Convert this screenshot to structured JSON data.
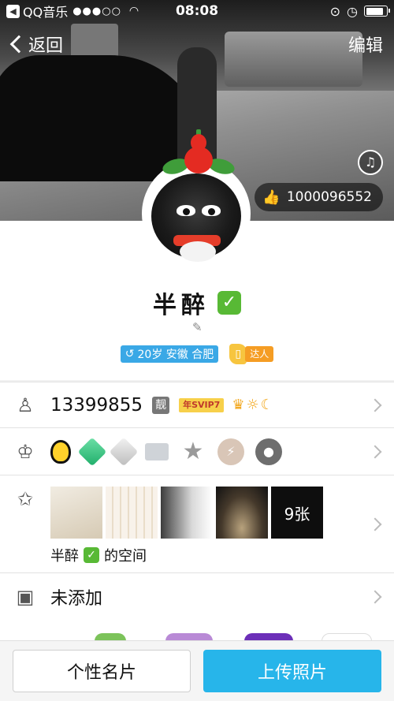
{
  "status_bar": {
    "app_name": "QQ音乐",
    "signal": "●●●○○",
    "wifi_icon": "wifi-icon",
    "time": "08:08"
  },
  "nav": {
    "back_label": "返回",
    "edit_label": "编辑"
  },
  "cover": {
    "likes": "1000096552"
  },
  "profile": {
    "name": "半醉",
    "tag_info": "20岁 安徽 合肥",
    "tag_daren": "达人"
  },
  "rows": {
    "qq_number": "13399855",
    "liang_label": "靓",
    "svip_label": "年SVIP7",
    "level_icons": "♛☼☾",
    "space_title": "半醉",
    "space_suffix": "的空间",
    "photo_count": "9张",
    "card_value": "未添加"
  },
  "bottom": {
    "card_button": "个性名片",
    "upload_button": "上传照片"
  },
  "colors": {
    "accent_blue": "#27b5ea",
    "tag_blue": "#3aa8e6",
    "verified_green": "#58b935",
    "daren_orange": "#f59d24"
  }
}
